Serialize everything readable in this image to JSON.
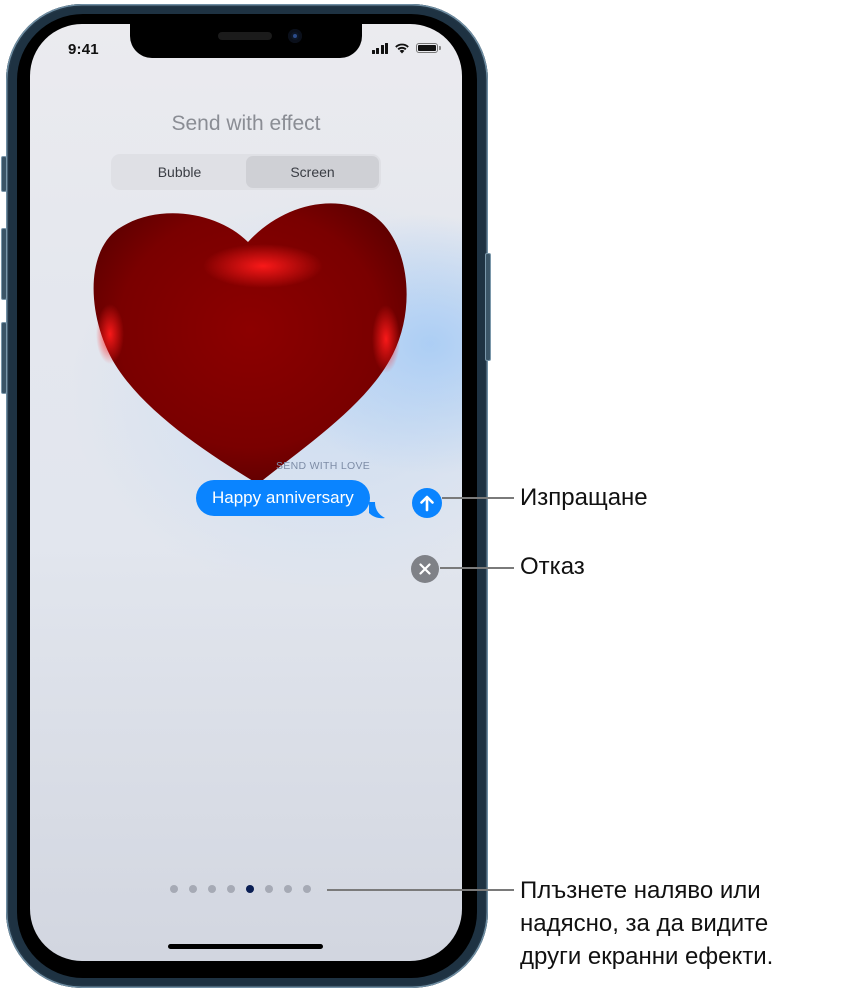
{
  "status_bar": {
    "time": "9:41",
    "icons": [
      "cellular-signal-icon",
      "wifi-icon",
      "battery-icon"
    ]
  },
  "screen": {
    "title": "Send with effect",
    "segmented_control": {
      "options": [
        {
          "label": "Bubble",
          "selected": false
        },
        {
          "label": "Screen",
          "selected": true
        }
      ]
    },
    "effect": {
      "name": "heart",
      "label": "SEND WITH LOVE"
    },
    "message": {
      "text": "Happy anniversary",
      "bubble_color": "#0a84ff"
    },
    "send_button": {
      "icon": "arrow-up-icon",
      "color": "#0a84ff"
    },
    "cancel_button": {
      "icon": "close-icon",
      "color": "#7f8187"
    },
    "page_indicator": {
      "total": 8,
      "current": 5,
      "active_color": "#0b1f54",
      "inactive_color": "#a6aab5"
    }
  },
  "callouts": {
    "send": "Изпращане",
    "cancel": "Отказ",
    "swipe": [
      "Плъзнете наляво или",
      "надясно, за да видите",
      "други екранни ефекти."
    ]
  }
}
